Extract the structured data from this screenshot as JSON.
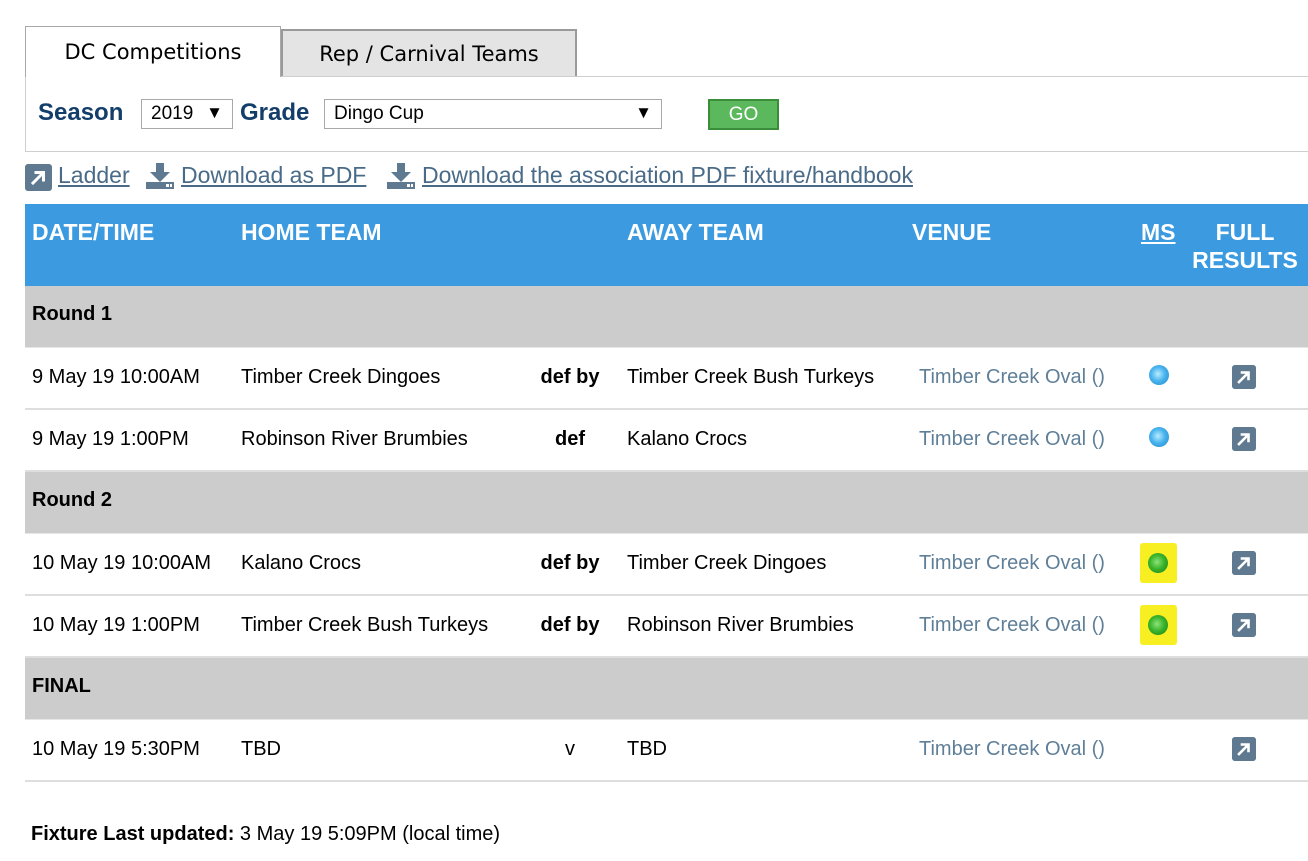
{
  "tabs": [
    {
      "label": "DC Competitions",
      "active": true
    },
    {
      "label": "Rep / Carnival Teams",
      "active": false
    }
  ],
  "filters": {
    "season_label": "Season",
    "season_value": "2019",
    "grade_label": "Grade",
    "grade_value": "Dingo Cup",
    "go_label": "GO"
  },
  "links": {
    "ladder": "Ladder",
    "download_pdf": "Download as PDF",
    "download_handbook": "Download the association PDF fixture/handbook"
  },
  "table": {
    "headers": {
      "datetime": "DATE/TIME",
      "home": "HOME TEAM",
      "away": "AWAY TEAM",
      "venue": "VENUE",
      "ms": "MS",
      "full_results_1": "FULL",
      "full_results_2": "RESULTS"
    },
    "rounds": [
      {
        "title": "Round 1",
        "games": [
          {
            "datetime": "9 May 19 10:00AM",
            "home": "Timber Creek Dingoes",
            "result": "def by",
            "away": "Timber Creek Bush Turkeys",
            "venue": "Timber Creek Oval ()",
            "ms": "blue"
          },
          {
            "datetime": "9 May 19 1:00PM",
            "home": "Robinson River Brumbies",
            "result": "def",
            "away": "Kalano Crocs",
            "venue": "Timber Creek Oval ()",
            "ms": "blue"
          }
        ]
      },
      {
        "title": "Round 2",
        "games": [
          {
            "datetime": "10 May 19 10:00AM",
            "home": "Kalano Crocs",
            "result": "def by",
            "away": "Timber Creek Dingoes",
            "venue": "Timber Creek Oval ()",
            "ms": "green"
          },
          {
            "datetime": "10 May 19 1:00PM",
            "home": "Timber Creek Bush Turkeys",
            "result": "def by",
            "away": "Robinson River Brumbies",
            "venue": "Timber Creek Oval ()",
            "ms": "green"
          }
        ]
      },
      {
        "title": "FINAL",
        "games": [
          {
            "datetime": "10 May 19 5:30PM",
            "home": "TBD",
            "result": "v",
            "away": "TBD",
            "venue": "Timber Creek Oval ()",
            "ms": "none"
          }
        ]
      }
    ]
  },
  "footer": {
    "label": "Fixture Last updated:",
    "value": "3 May 19 5:09PM (local time)"
  },
  "colors": {
    "header_bg": "#3c9be0",
    "round_bg": "#cccccc",
    "label_navy": "#133e6a",
    "link": "#4a6b88",
    "go_green": "#5cb85c",
    "highlight": "#f7ef21"
  }
}
